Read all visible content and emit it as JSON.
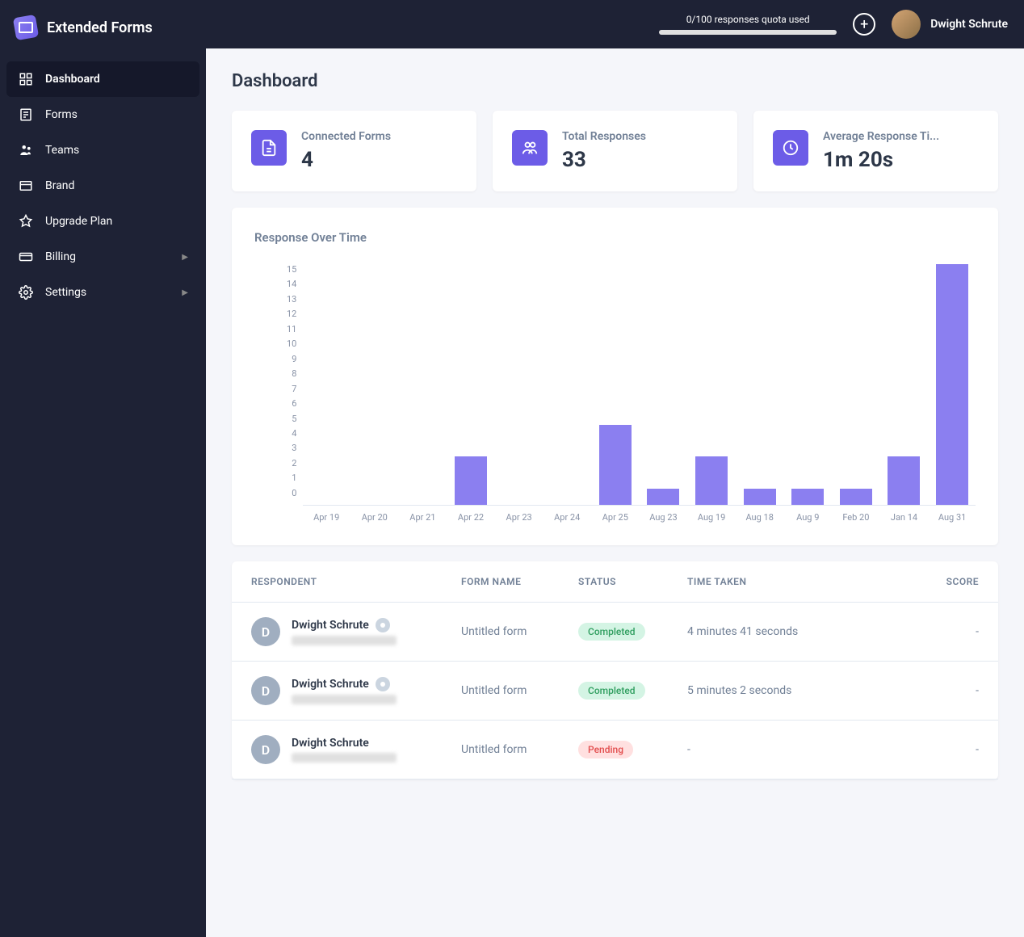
{
  "brand": "Extended Forms",
  "header": {
    "quota_text": "0/100 responses quota used",
    "user_name": "Dwight Schrute"
  },
  "sidebar": {
    "items": [
      {
        "label": "Dashboard",
        "icon": "dashboard",
        "active": true,
        "expandable": false
      },
      {
        "label": "Forms",
        "icon": "forms",
        "active": false,
        "expandable": false
      },
      {
        "label": "Teams",
        "icon": "teams",
        "active": false,
        "expandable": false
      },
      {
        "label": "Brand",
        "icon": "brand",
        "active": false,
        "expandable": false
      },
      {
        "label": "Upgrade Plan",
        "icon": "upgrade",
        "active": false,
        "expandable": false
      },
      {
        "label": "Billing",
        "icon": "billing",
        "active": false,
        "expandable": true
      },
      {
        "label": "Settings",
        "icon": "settings",
        "active": false,
        "expandable": true
      }
    ]
  },
  "page": {
    "title": "Dashboard"
  },
  "stats": [
    {
      "label": "Connected Forms",
      "value": "4",
      "icon": "file"
    },
    {
      "label": "Total Responses",
      "value": "33",
      "icon": "users"
    },
    {
      "label": "Average Response Ti...",
      "value": "1m 20s",
      "icon": "clock"
    }
  ],
  "chart": {
    "title": "Response Over Time"
  },
  "chart_data": {
    "type": "bar",
    "categories": [
      "Apr 19",
      "Apr 20",
      "Apr 21",
      "Apr 22",
      "Apr 23",
      "Apr 24",
      "Apr 25",
      "Aug 23",
      "Aug 19",
      "Aug 18",
      "Aug 9",
      "Feb 20",
      "Jan 14",
      "Aug 31"
    ],
    "values": [
      0,
      0,
      0,
      3,
      0,
      0,
      5,
      1,
      3,
      1,
      1,
      1,
      3,
      15
    ],
    "ylabel": "",
    "xlabel": "",
    "ylim": [
      0,
      15
    ],
    "yticks": [
      0,
      1,
      2,
      3,
      4,
      5,
      6,
      7,
      8,
      9,
      10,
      11,
      12,
      13,
      14,
      15
    ]
  },
  "table": {
    "headers": {
      "respondent": "RESPONDENT",
      "form": "FORM NAME",
      "status": "STATUS",
      "time": "TIME TAKEN",
      "score": "SCORE"
    },
    "rows": [
      {
        "initial": "D",
        "name": "Dwight Schrute",
        "form": "Untitled form",
        "status": "Completed",
        "status_class": "completed",
        "time": "4 minutes 41 seconds",
        "score": "-",
        "has_eye": true
      },
      {
        "initial": "D",
        "name": "Dwight Schrute",
        "form": "Untitled form",
        "status": "Completed",
        "status_class": "completed",
        "time": "5 minutes 2 seconds",
        "score": "-",
        "has_eye": true
      },
      {
        "initial": "D",
        "name": "Dwight Schrute",
        "form": "Untitled form",
        "status": "Pending",
        "status_class": "pending",
        "time": "-",
        "score": "-",
        "has_eye": false
      }
    ]
  }
}
